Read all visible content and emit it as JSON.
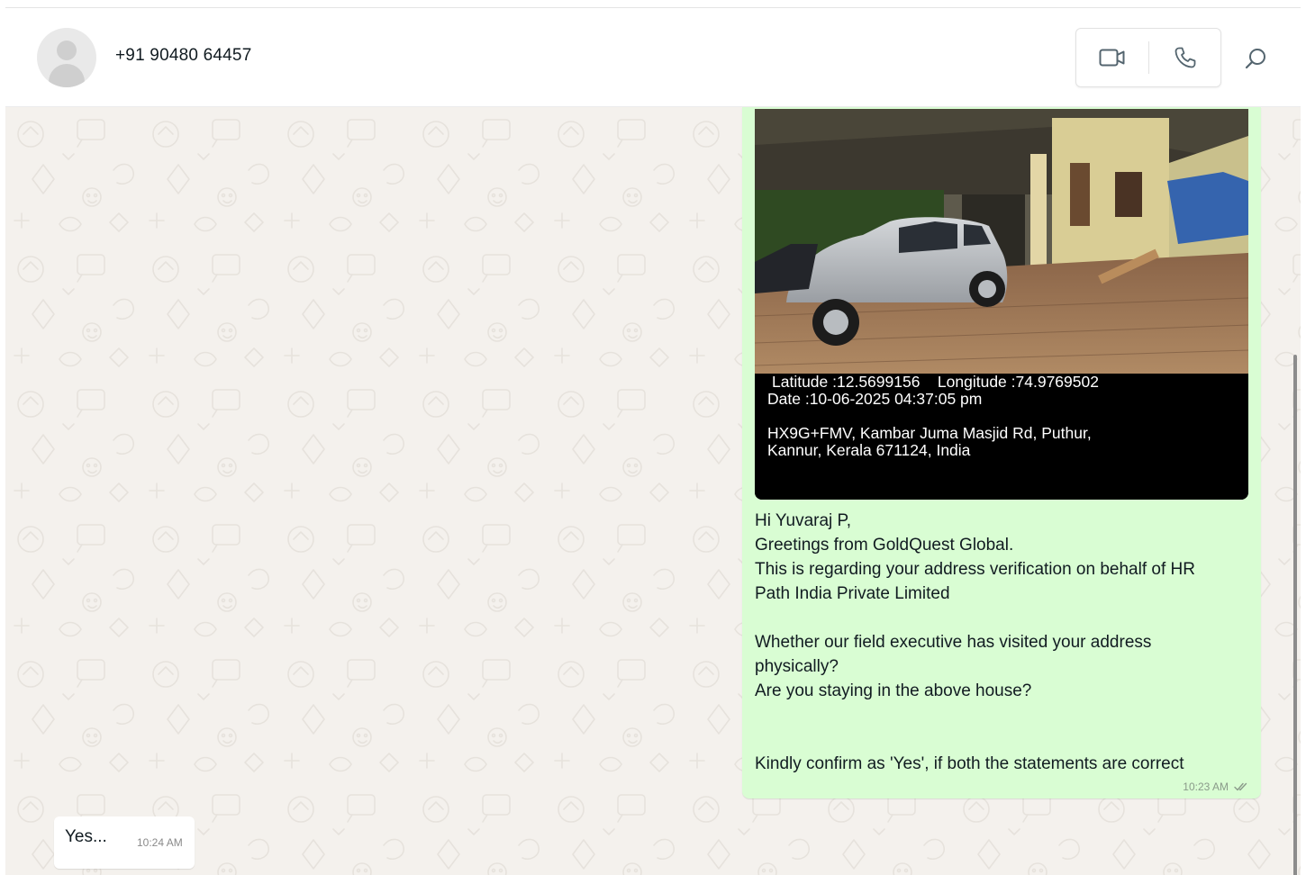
{
  "header": {
    "contact_name": "+91 90480 64457",
    "avatar_icon": "default-avatar-icon",
    "video_call_icon": "video-camera-icon",
    "voice_call_icon": "phone-icon",
    "search_icon": "search-icon"
  },
  "messages": {
    "outgoing": {
      "photo": {
        "latlon_line": "Latitude :12.5699156    Longitude :74.9769502",
        "date_line": "Date :10-06-2025 04:37:05 pm",
        "address_line1": "HX9G+FMV, Kambar Juma Masjid Rd, Puthur,",
        "address_line2": "Kannur, Kerala 671124, India"
      },
      "lines": [
        "Hi Yuvaraj P,",
        "Greetings from GoldQuest Global.",
        "This is regarding your address verification on behalf of HR",
        "Path India Private Limited",
        "",
        "Whether our field executive has visited your address",
        "physically?",
        "Are you staying in the above house?",
        "",
        "",
        "Kindly confirm as 'Yes', if both the statements are correct"
      ],
      "time": "10:23 AM",
      "status_icon": "double-check-icon"
    },
    "incoming": {
      "text": "Yes...",
      "time": "10:24 AM"
    }
  },
  "colors": {
    "outgoing_bubble": "#d9fdd3",
    "incoming_bubble": "#ffffff",
    "chat_background": "#f4f1ed",
    "header_background": "#ffffff"
  }
}
